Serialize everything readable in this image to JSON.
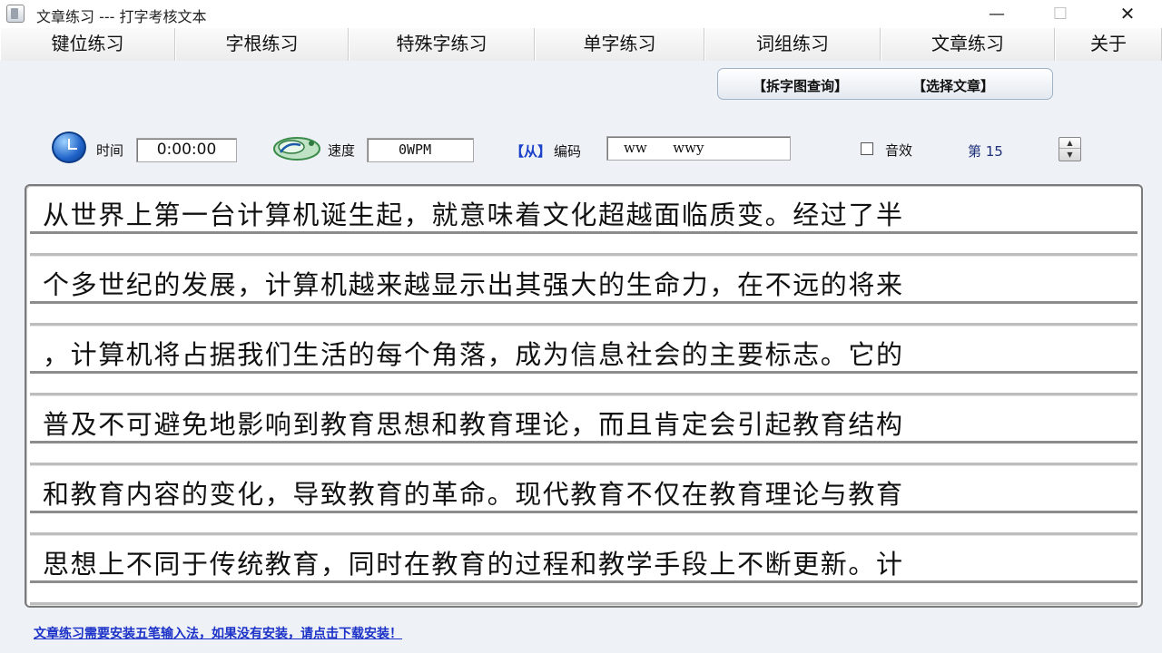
{
  "window": {
    "title": "文章练习 --- 打字考核文本",
    "minimize_icon": "minimize-icon",
    "maximize_icon": "maximize-icon",
    "close_icon": "close-icon",
    "minimize_glyph": "—",
    "maximize_glyph": "☐",
    "close_glyph": "✕"
  },
  "menu": {
    "items": [
      {
        "label": "键位练习"
      },
      {
        "label": "字根练习"
      },
      {
        "label": "特殊字练习"
      },
      {
        "label": "单字练习"
      },
      {
        "label": "词组练习"
      },
      {
        "label": "文章练习"
      },
      {
        "label": "关于"
      }
    ]
  },
  "subpanel": {
    "split_char_lookup": "【拆字图查询】",
    "select_article": "【选择文章】"
  },
  "status": {
    "time_label": "时间",
    "time_value": "0:00:00",
    "speed_label": "速度",
    "speed_value": "0WPM",
    "code_tag": "【从】",
    "code_label": "编码",
    "code_value": "ww      wwy",
    "sound_label": "音效",
    "page_label": "第 15",
    "spinner_up": "▲",
    "spinner_down": "▼"
  },
  "article": {
    "lines": [
      {
        "text": "从世界上第一台计算机诞生起，就意味着文化超越面临质变。经过了半"
      },
      {
        "text": "个多世纪的发展，计算机越来越显示出其强大的生命力，在不远的将来"
      },
      {
        "text": "，计算机将占据我们生活的每个角落，成为信息社会的主要标志。它的"
      },
      {
        "text": "普及不可避免地影响到教育思想和教育理论，而且肯定会引起教育结构"
      },
      {
        "text": "和教育内容的变化，导致教育的革命。现代教育不仅在教育理论与教育"
      },
      {
        "text": "思想上不同于传统教育，同时在教育的过程和教学手段上不断更新。计"
      }
    ]
  },
  "footer": {
    "link_text": "文章练习需要安装五笔输入法，如果没有安装，请点击下载安装！"
  },
  "colors": {
    "link": "#1b31c7",
    "code_tag": "#1a3fc8",
    "background": "#eef2f6"
  }
}
